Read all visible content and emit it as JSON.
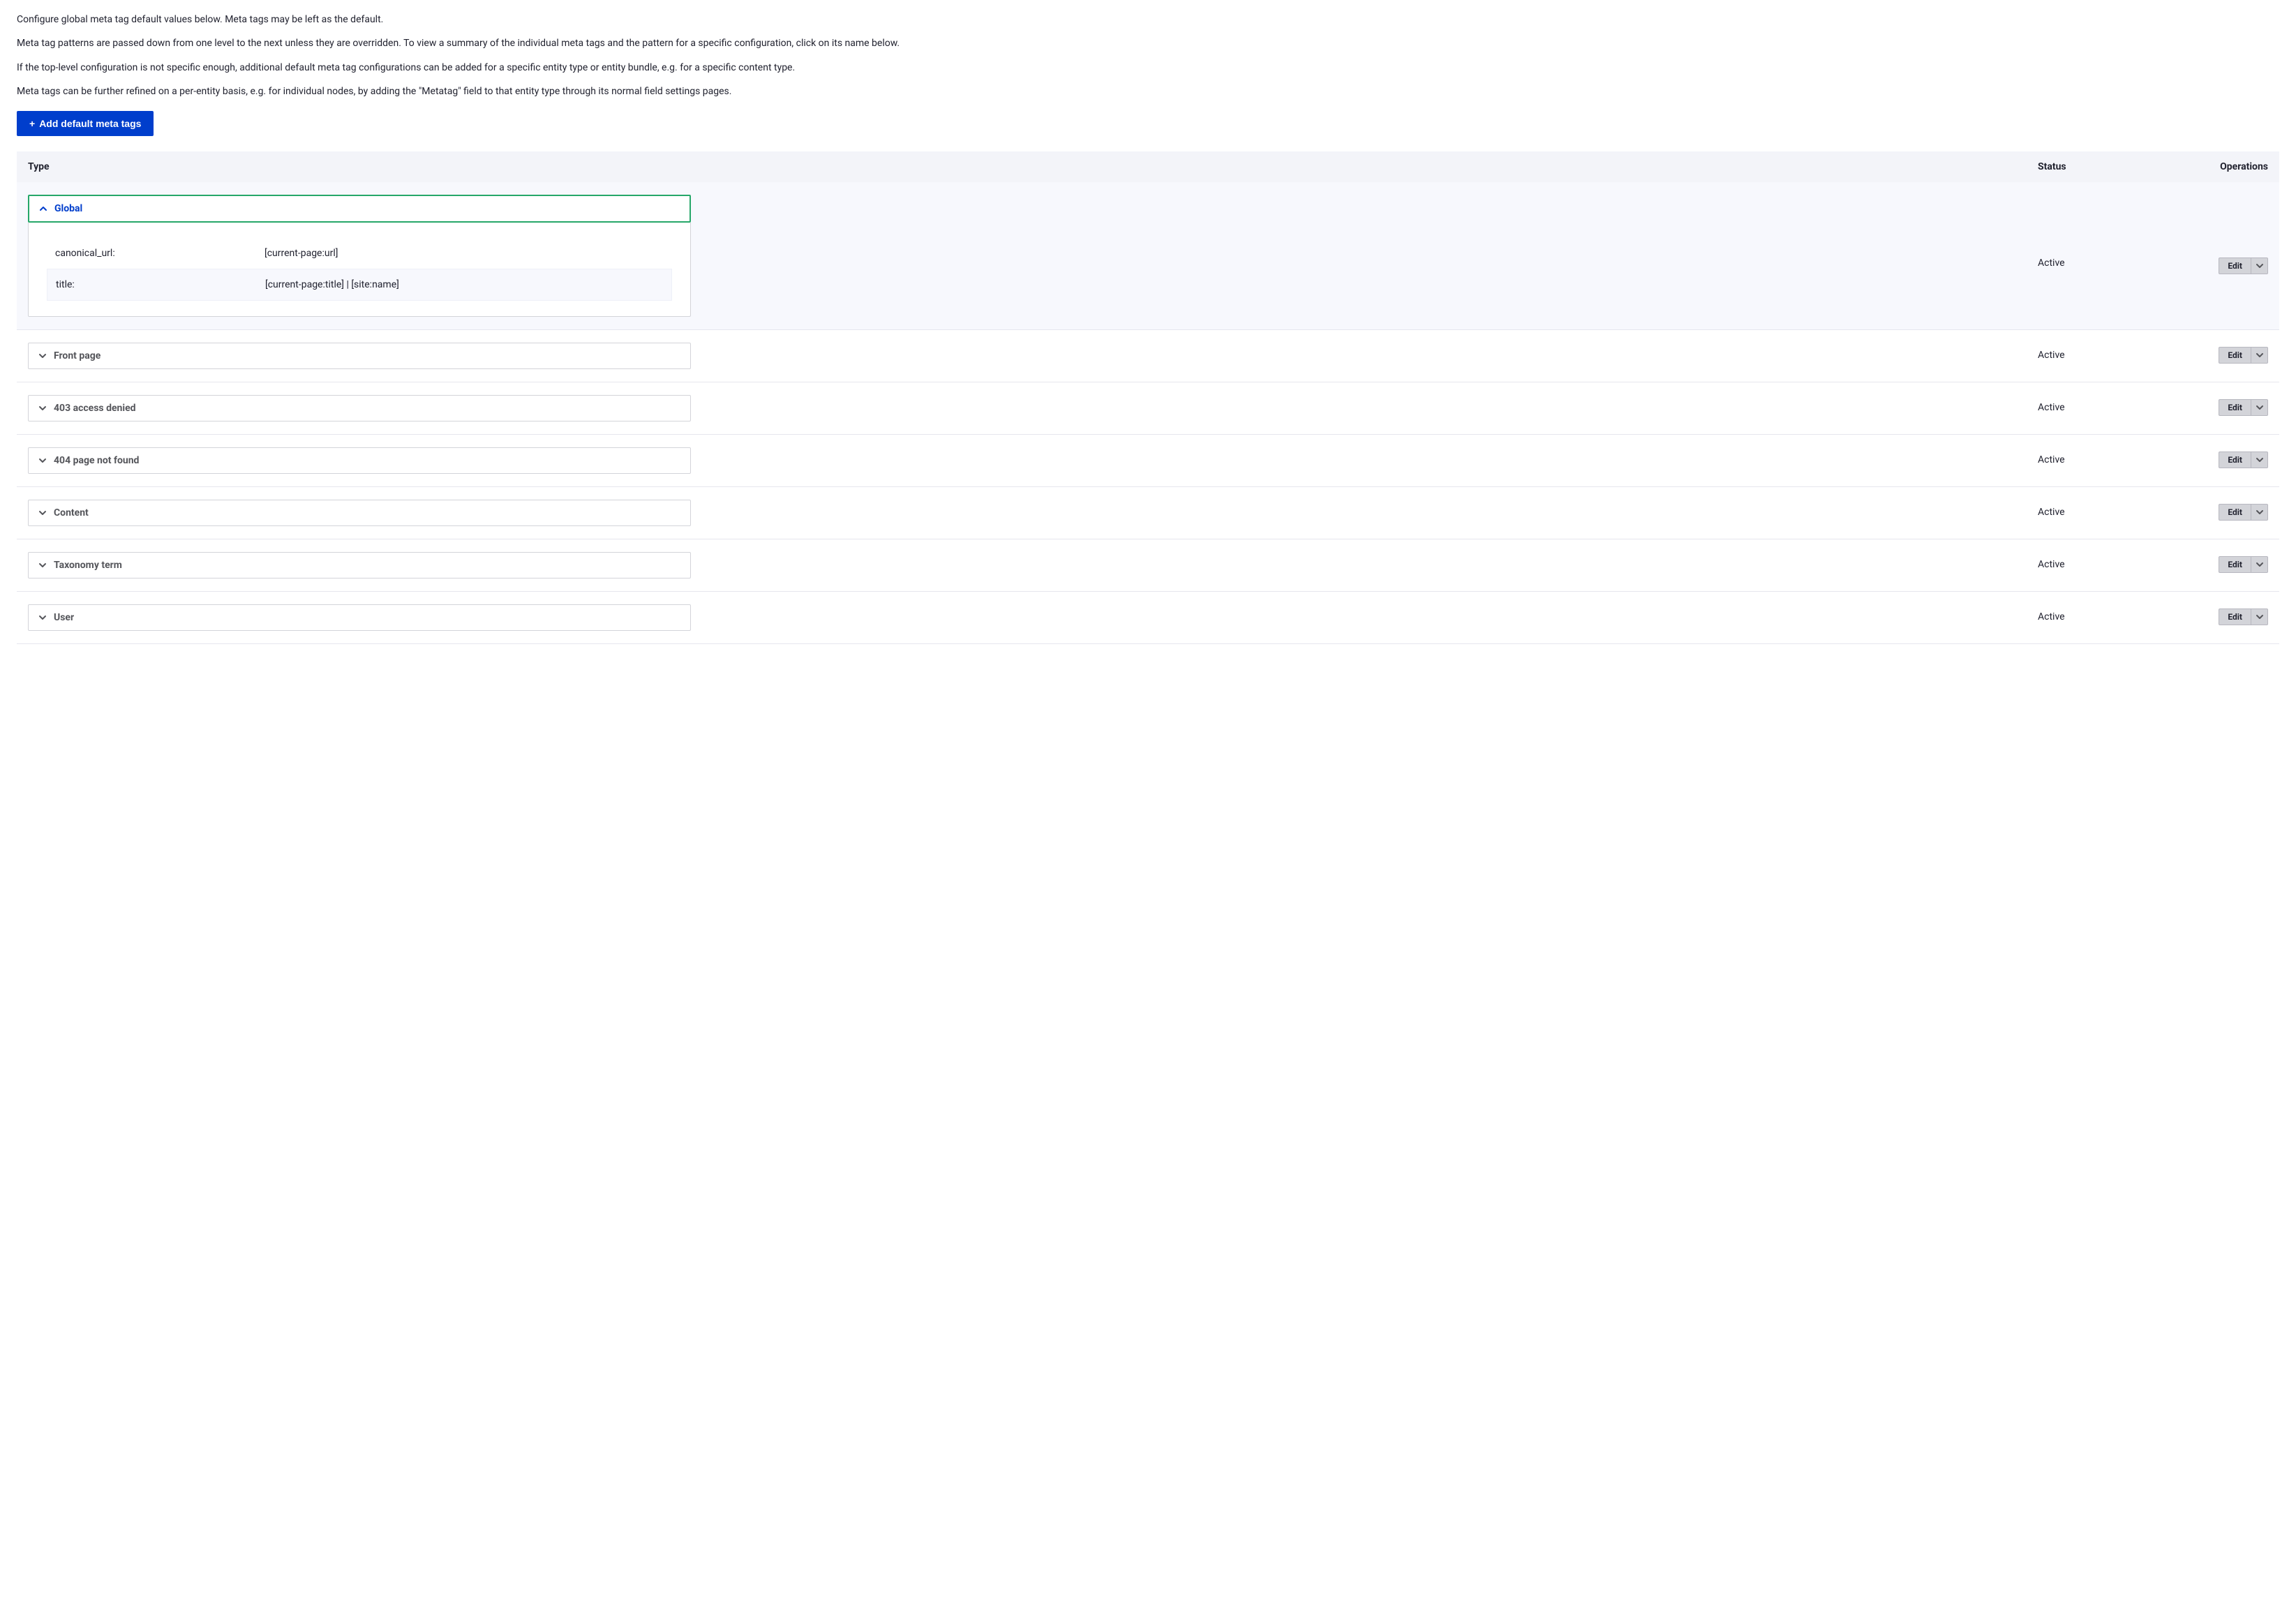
{
  "intro": {
    "p1": "Configure global meta tag default values below. Meta tags may be left as the default.",
    "p2": "Meta tag patterns are passed down from one level to the next unless they are overridden. To view a summary of the individual meta tags and the pattern for a specific configuration, click on its name below.",
    "p3": "If the top-level configuration is not specific enough, additional default meta tag configurations can be added for a specific entity type or entity bundle, e.g. for a specific content type.",
    "p4": "Meta tags can be further refined on a per-entity basis, e.g. for individual nodes, by adding the \"Metatag\" field to that entity type through its normal field settings pages."
  },
  "add_button": "Add default meta tags",
  "table": {
    "headers": {
      "type": "Type",
      "status": "Status",
      "ops": "Operations"
    },
    "edit_label": "Edit",
    "rows": [
      {
        "label": "Global",
        "status": "Active",
        "expanded": true,
        "meta": [
          {
            "key": "canonical_url:",
            "value": "[current-page:url]"
          },
          {
            "key": "title:",
            "value": "[current-page:title] | [site:name]"
          }
        ]
      },
      {
        "label": "Front page",
        "status": "Active",
        "expanded": false
      },
      {
        "label": "403 access denied",
        "status": "Active",
        "expanded": false
      },
      {
        "label": "404 page not found",
        "status": "Active",
        "expanded": false
      },
      {
        "label": "Content",
        "status": "Active",
        "expanded": false
      },
      {
        "label": "Taxonomy term",
        "status": "Active",
        "expanded": false
      },
      {
        "label": "User",
        "status": "Active",
        "expanded": false
      }
    ]
  }
}
